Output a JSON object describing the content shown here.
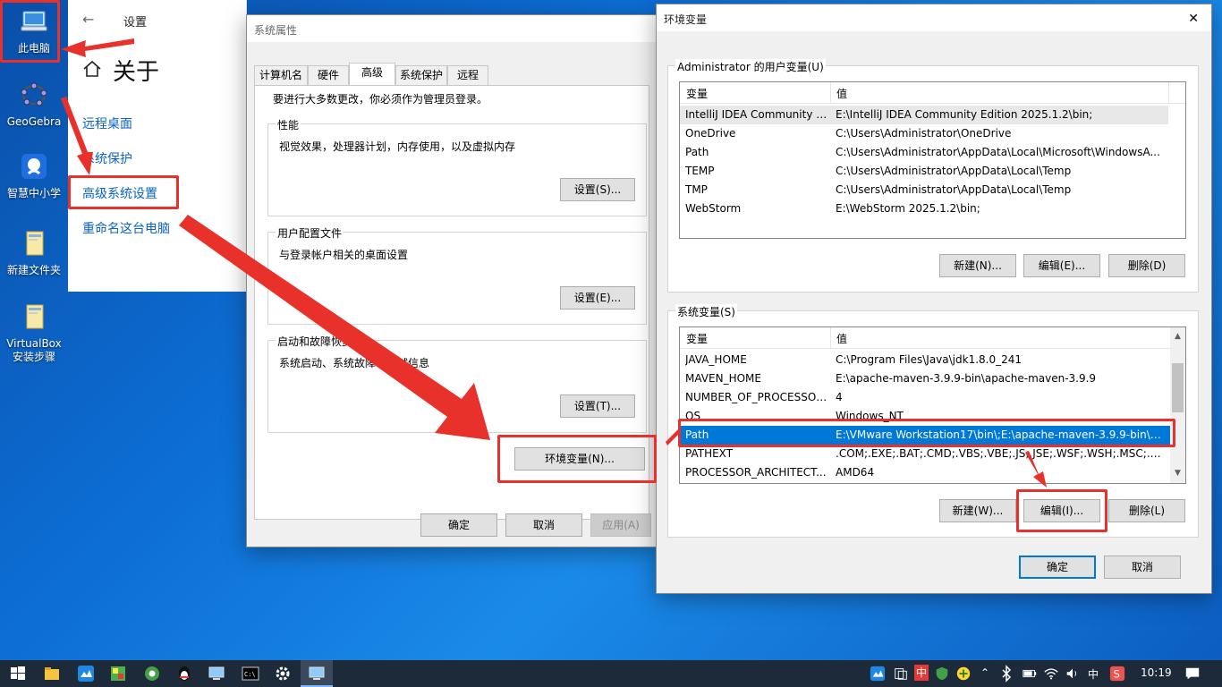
{
  "desktop": {
    "icons": [
      {
        "label": "此电脑"
      },
      {
        "label": "GeoGebra"
      },
      {
        "label": "智慧中小学"
      },
      {
        "label": "新建文件夹"
      },
      {
        "label": "VirtualBox安装步骤"
      }
    ]
  },
  "settings": {
    "title": "设置",
    "heading": "关于",
    "nav": [
      "远程桌面",
      "系统保护",
      "高级系统设置",
      "重命名这台电脑"
    ]
  },
  "sysprops": {
    "title": "系统属性",
    "tabs": [
      "计算机名",
      "硬件",
      "高级",
      "系统保护",
      "远程"
    ],
    "notice": "要进行大多数更改，你必须作为管理员登录。",
    "performance": {
      "label": "性能",
      "desc": "视觉效果，处理器计划，内存使用，以及虚拟内存",
      "button": "设置(S)..."
    },
    "profiles": {
      "label": "用户配置文件",
      "desc": "与登录帐户相关的桌面设置",
      "button": "设置(E)..."
    },
    "startup": {
      "label": "启动和故障恢复",
      "desc": "系统启动、系统故障和调试信息",
      "button": "设置(T)..."
    },
    "env_button": "环境变量(N)...",
    "ok": "确定",
    "cancel": "取消",
    "apply": "应用(A)"
  },
  "envvars": {
    "title": "环境变量",
    "close_glyph": "✕",
    "user_section": "Administrator 的用户变量(U)",
    "col_var": "变量",
    "col_val": "值",
    "user_rows": [
      {
        "name": "IntelliJ IDEA Community E...",
        "value": "E:\\IntelliJ IDEA Community Edition 2025.1.2\\bin;"
      },
      {
        "name": "OneDrive",
        "value": "C:\\Users\\Administrator\\OneDrive"
      },
      {
        "name": "Path",
        "value": "C:\\Users\\Administrator\\AppData\\Local\\Microsoft\\WindowsA..."
      },
      {
        "name": "TEMP",
        "value": "C:\\Users\\Administrator\\AppData\\Local\\Temp"
      },
      {
        "name": "TMP",
        "value": "C:\\Users\\Administrator\\AppData\\Local\\Temp"
      },
      {
        "name": "WebStorm",
        "value": "E:\\WebStorm 2025.1.2\\bin;"
      }
    ],
    "user_new": "新建(N)...",
    "user_edit": "编辑(E)...",
    "user_delete": "删除(D)",
    "system_section": "系统变量(S)",
    "system_rows": [
      {
        "name": "JAVA_HOME",
        "value": "C:\\Program Files\\Java\\jdk1.8.0_241"
      },
      {
        "name": "MAVEN_HOME",
        "value": "E:\\apache-maven-3.9.9-bin\\apache-maven-3.9.9"
      },
      {
        "name": "NUMBER_OF_PROCESSORS",
        "value": "4"
      },
      {
        "name": "OS",
        "value": "Windows_NT"
      },
      {
        "name": "Path",
        "value": "E:\\VMware Workstation17\\bin\\;E:\\apache-maven-3.9.9-bin\\a..."
      },
      {
        "name": "PATHEXT",
        "value": ".COM;.EXE;.BAT;.CMD;.VBS;.VBE;.JS;.JSE;.WSF;.WSH;.MSC;.PY;.P..."
      },
      {
        "name": "PROCESSOR_ARCHITECT...",
        "value": "AMD64"
      }
    ],
    "sys_new": "新建(W)...",
    "sys_edit": "编辑(I)...",
    "sys_delete": "删除(L)",
    "ok": "确定",
    "cancel": "取消"
  },
  "taskbar": {
    "ime": "中",
    "ime2": "中",
    "clock": "10:19"
  },
  "colors": {
    "accent": "#0078d7",
    "annotation_red": "#e8312a",
    "link_blue": "#0a62c4"
  }
}
